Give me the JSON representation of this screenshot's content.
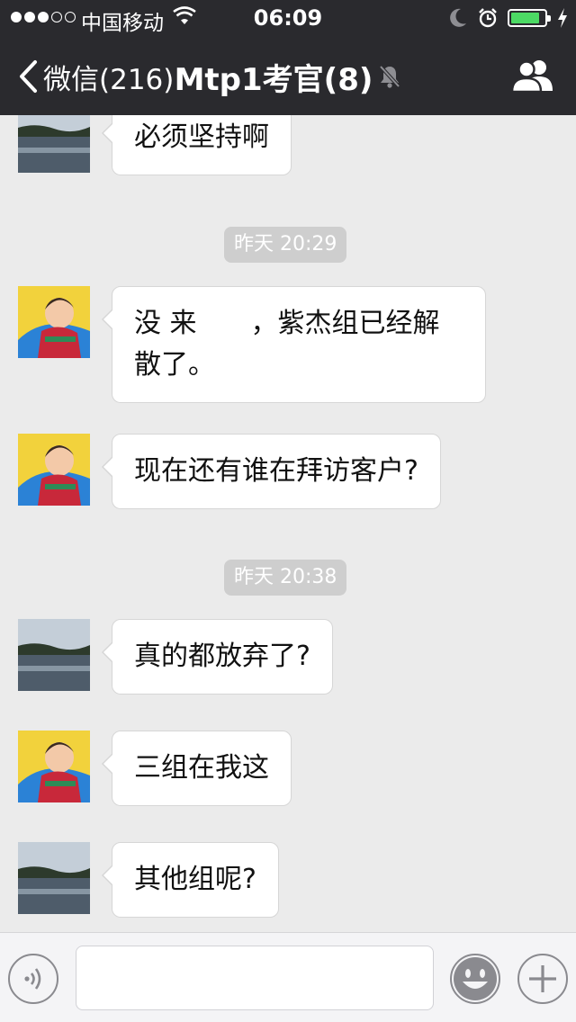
{
  "status_bar": {
    "carrier": "中国移动",
    "time": "06:09",
    "signal_bars_filled": 3,
    "signal_bars_total": 5,
    "battery_level": 0.85,
    "icons": [
      "signal-dots-icon",
      "wifi-icon",
      "moon-icon",
      "alarm-icon",
      "battery-icon",
      "charging-bolt-icon"
    ]
  },
  "nav": {
    "back_label": "微信(216)",
    "title": "Mtp1考官(8)",
    "icons": [
      "back-chevron-icon",
      "mute-bell-icon",
      "group-members-icon"
    ]
  },
  "messages": [
    {
      "type": "message",
      "sender": "landscape",
      "text": "必须坚持啊"
    },
    {
      "type": "time",
      "text": "昨天 20:29"
    },
    {
      "type": "message",
      "sender": "baby",
      "text": "没 来　　，紫杰组已经解",
      "text2": "散了。"
    },
    {
      "type": "message",
      "sender": "baby",
      "text": "现在还有谁在拜访客户?"
    },
    {
      "type": "time",
      "text": "昨天 20:38"
    },
    {
      "type": "message",
      "sender": "landscape",
      "text": "真的都放弃了?"
    },
    {
      "type": "message",
      "sender": "baby",
      "text": "三组在我这"
    },
    {
      "type": "message",
      "sender": "landscape",
      "text": "其他组呢?"
    }
  ],
  "input_bar": {
    "placeholder": "",
    "icons": [
      "voice-icon",
      "emoji-icon",
      "plus-icon"
    ]
  },
  "colors": {
    "nav_bg": "#2a2a2e",
    "chat_bg": "#ebebeb",
    "bubble_bg": "#ffffff",
    "timestamp_bg": "#cecece",
    "battery_fill": "#4cd964"
  }
}
